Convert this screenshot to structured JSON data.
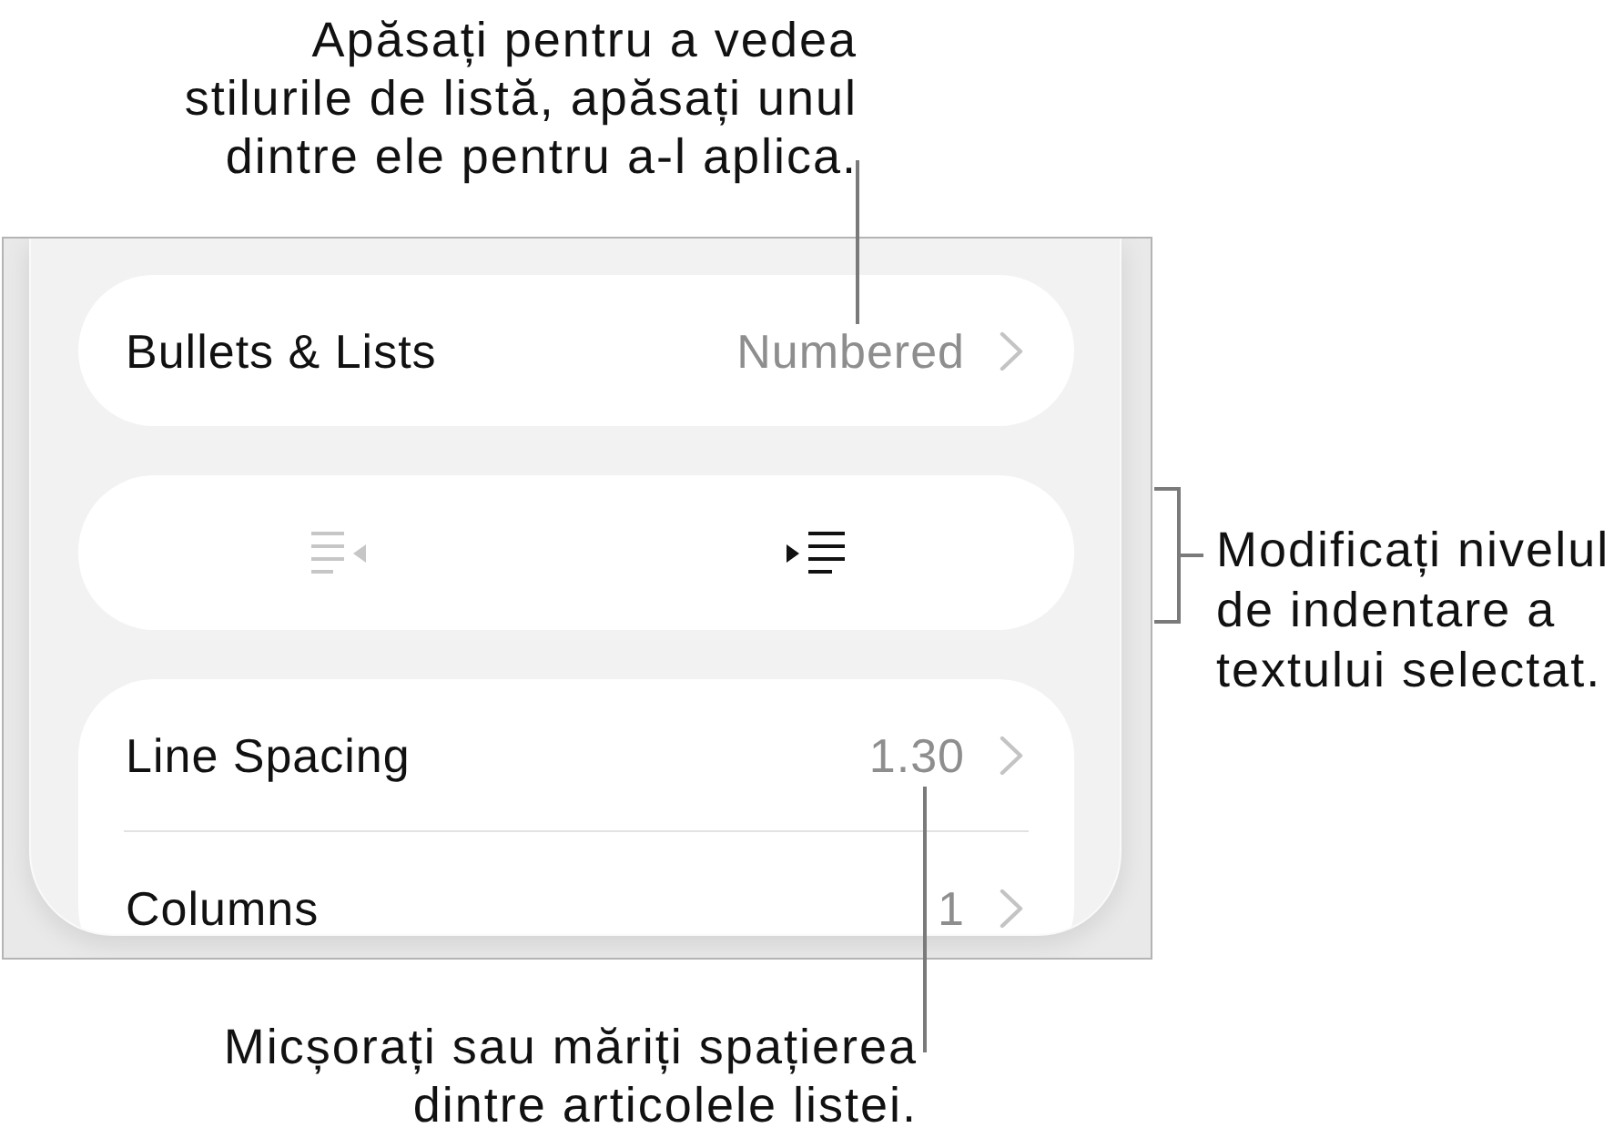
{
  "callouts": [
    {
      "kind": "leader",
      "text": "Apăsați pentru a vedea\nstilurile de listă, apăsați unul\ndintre ele pentru a-l aplica."
    },
    {
      "kind": "bracket",
      "text": "Modificați nivelul\nde indentare a\ntextului selectat."
    },
    {
      "kind": "leader",
      "text": "Micșorați sau măriți spațierea\ndintre articolele listei."
    }
  ],
  "panel": {
    "groups": [
      {
        "kind": "rows",
        "rows": [
          {
            "label": "Bullets & Lists",
            "value": "Numbered"
          }
        ]
      },
      {
        "kind": "indent_buttons",
        "buttons": [
          {
            "kind": "outdent",
            "disabled": true
          },
          {
            "kind": "indent",
            "disabled": false
          }
        ]
      },
      {
        "kind": "rows",
        "rows": [
          {
            "label": "Line Spacing",
            "value": "1.30"
          },
          {
            "label": "Columns",
            "value": "1"
          }
        ]
      }
    ]
  }
}
